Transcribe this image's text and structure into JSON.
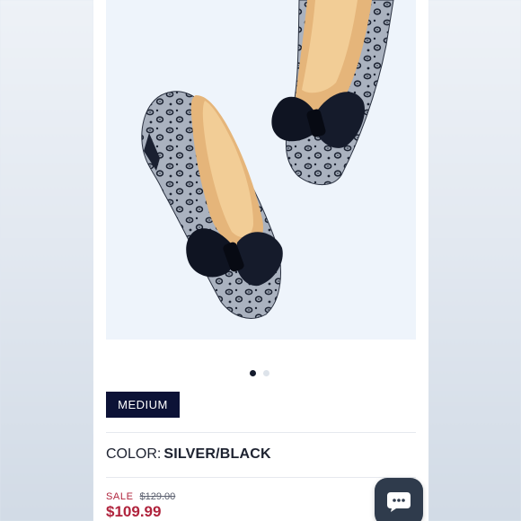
{
  "product": {
    "image_icon": "leopard-print-bow-flat-shoes",
    "carousel": {
      "total": 2,
      "active_index": 0
    }
  },
  "size": {
    "label": "MEDIUM"
  },
  "color": {
    "label": "COLOR:",
    "value": "SILVER/BLACK"
  },
  "price": {
    "sale_label": "SALE",
    "original": "$129.00",
    "current": "$109.99"
  },
  "chat": {
    "icon": "chat-bubble-icon"
  },
  "colors": {
    "accent_sale": "#b0243d",
    "chip_background": "#0c1236",
    "chat_background": "#2f3b4c"
  }
}
